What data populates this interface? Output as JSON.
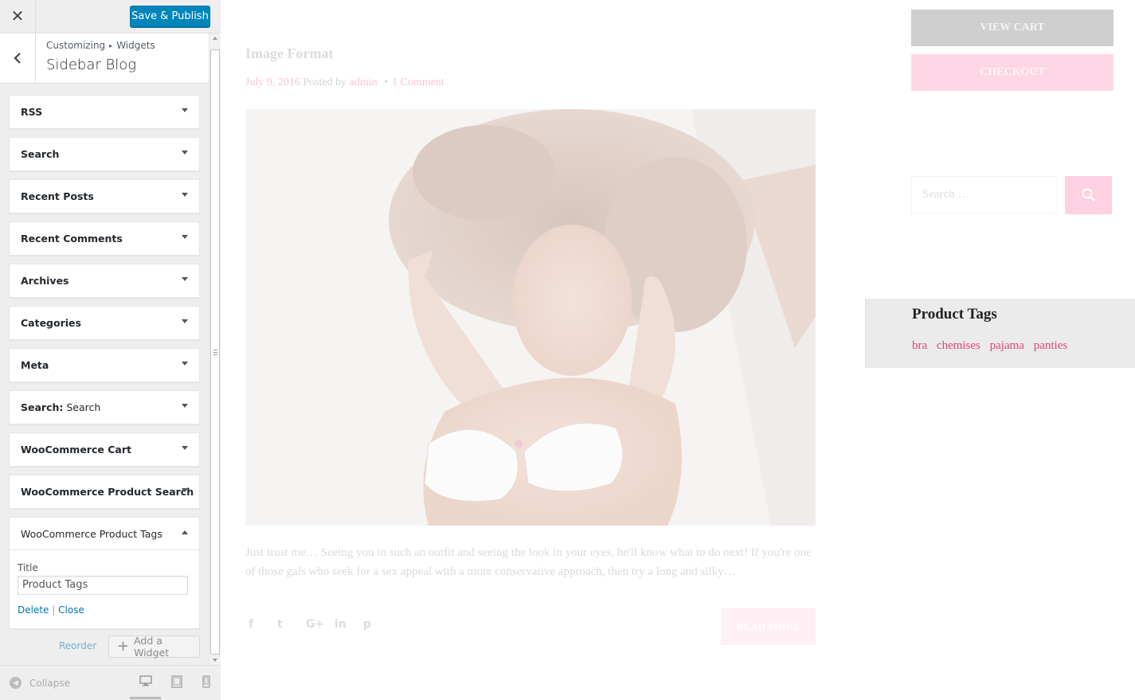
{
  "customizer": {
    "close_icon": "close-icon",
    "save_label": "Save & Publish",
    "breadcrumb": {
      "root": "Customizing",
      "section": "Widgets"
    },
    "section_title": "Sidebar Blog",
    "widgets": [
      {
        "title": "RSS",
        "in_title": ""
      },
      {
        "title": "Search",
        "in_title": ""
      },
      {
        "title": "Recent Posts",
        "in_title": ""
      },
      {
        "title": "Recent Comments",
        "in_title": ""
      },
      {
        "title": "Archives",
        "in_title": ""
      },
      {
        "title": "Categories",
        "in_title": ""
      },
      {
        "title": "Meta",
        "in_title": ""
      },
      {
        "title": "Search:",
        "in_title": " Search"
      },
      {
        "title": "WooCommerce Cart",
        "in_title": ""
      },
      {
        "title": "WooCommerce Product Search",
        "in_title": ""
      },
      {
        "title": "WooCommerce Product Tags",
        "in_title": ""
      }
    ],
    "open_widget": {
      "title_label": "Title",
      "title_value": "Product Tags",
      "delete_label": "Delete",
      "separator": "|",
      "close_label": "Close"
    },
    "reorder_label": "Reorder",
    "add_widget_label": "Add a Widget",
    "collapse_label": "Collapse",
    "accent_color": "#0085ba"
  },
  "preview": {
    "post": {
      "title": "Image Format",
      "date": "July 9, 2016",
      "posted_by": "Posted by",
      "author": "admin",
      "bullet": "•",
      "comments": "1 Comment",
      "excerpt": "Just trust me… Seeing you in such an outfit and seeing the look in your eyes, he'll know what to do next! If you're one of those gals who seek for a sex appeal with a more conservative approach, then try a long and silky…",
      "social": [
        "f",
        "t",
        "G+",
        "in",
        "p"
      ],
      "read_more": "READ MORE"
    },
    "cart": {
      "view_cart": "VIEW CART",
      "checkout": "CHECKOUT"
    },
    "search": {
      "placeholder": "Search …"
    },
    "product_tags": {
      "title": "Product Tags",
      "tags": [
        "bra",
        "chemises",
        "pajama",
        "panties"
      ],
      "tag_color": "#e0457b"
    }
  }
}
